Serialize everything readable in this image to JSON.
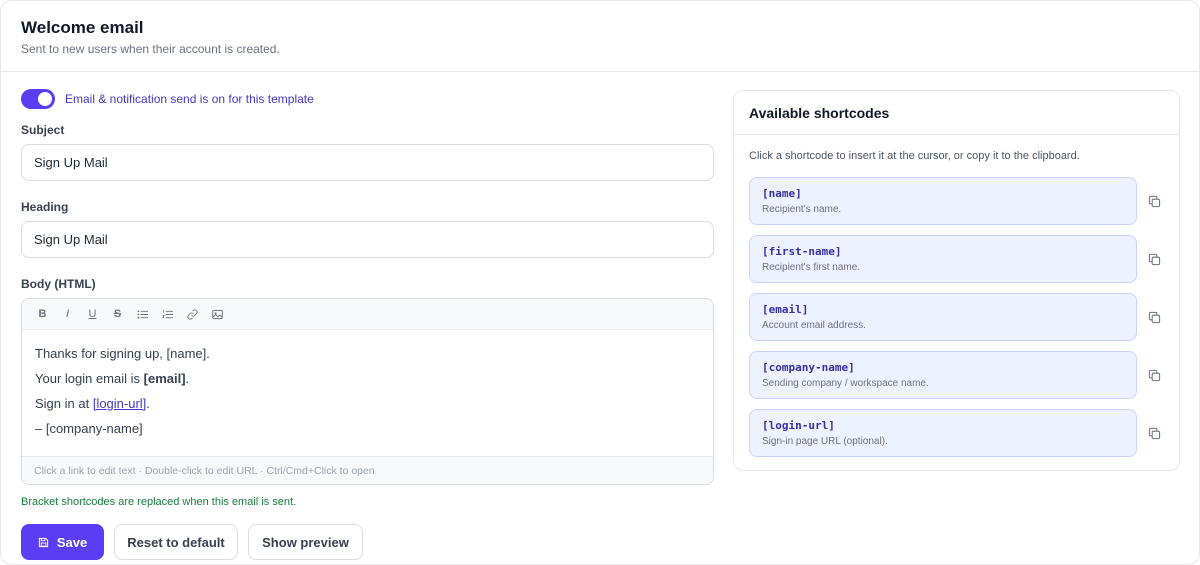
{
  "header": {
    "title": "Welcome email",
    "subtitle": "Sent to new users when their account is created."
  },
  "toggle": {
    "label": "Email & notification send is on for this template",
    "on": true
  },
  "subject": {
    "label": "Subject",
    "value": "Sign Up Mail"
  },
  "heading": {
    "label": "Heading",
    "value": "Sign Up Mail"
  },
  "body": {
    "label": "Body (HTML)",
    "toolbar": [
      "B",
      "I",
      "U",
      "S"
    ],
    "line1": "Thanks for signing up, [name].",
    "line2_prefix": "Your login email is ",
    "line2_bold": "[email]",
    "line2_suffix": ".",
    "line3_prefix": "Sign in at ",
    "line3_link": "[login-url]",
    "line3_suffix": ".",
    "line4": "– [company-name]",
    "footer_hint": "Click a link to edit text · Double-click to edit URL · Ctrl/Cmd+Click to open"
  },
  "replace_hint": "Bracket shortcodes are replaced when this email is sent.",
  "actions": {
    "save": "Save",
    "reset": "Reset to default",
    "preview": "Show preview"
  },
  "shortcodes": {
    "title": "Available shortcodes",
    "intro": "Click a shortcode to insert it at the cursor, or copy it to the clipboard.",
    "items": [
      {
        "code": "[name]",
        "desc": "Recipient's name."
      },
      {
        "code": "[first-name]",
        "desc": "Recipient's first name."
      },
      {
        "code": "[email]",
        "desc": "Account email address."
      },
      {
        "code": "[company-name]",
        "desc": "Sending company / workspace name."
      },
      {
        "code": "[login-url]",
        "desc": "Sign-in page URL (optional)."
      }
    ]
  },
  "colors": {
    "accent": "#5b3df5",
    "success": "#15803d",
    "chip_bg": "#eef2ff"
  }
}
